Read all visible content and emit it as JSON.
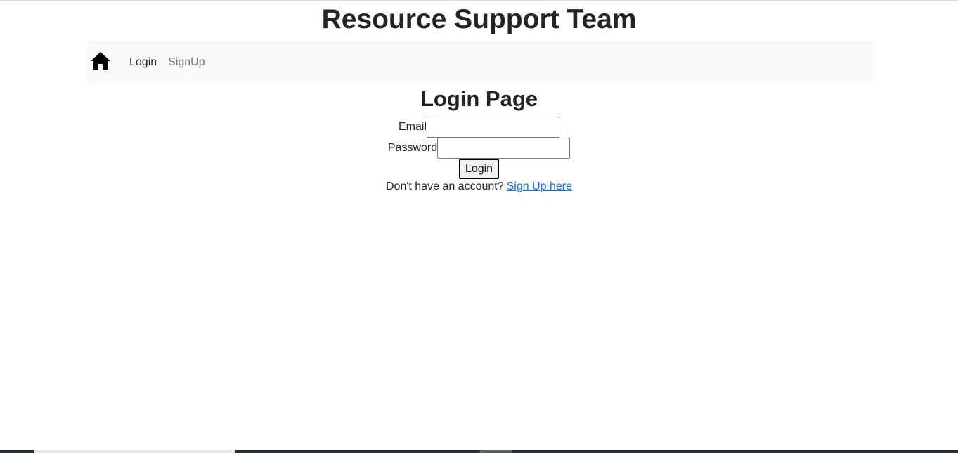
{
  "header": {
    "title": "Resource Support Team"
  },
  "nav": {
    "home_icon": "home-icon",
    "items": [
      {
        "label": "Login"
      },
      {
        "label": "SignUp"
      }
    ]
  },
  "main": {
    "heading": "Login Page",
    "email": {
      "label": "Email",
      "value": "",
      "placeholder": ""
    },
    "password": {
      "label": "Password",
      "value": "",
      "placeholder": ""
    },
    "submit_label": "Login",
    "signup_prompt": "Don't have an account?",
    "signup_link": "Sign Up here"
  },
  "colors": {
    "navbar_bg": "#f8f9fa",
    "link": "#0d6efd",
    "text": "#212529",
    "muted": "#6c757d"
  }
}
